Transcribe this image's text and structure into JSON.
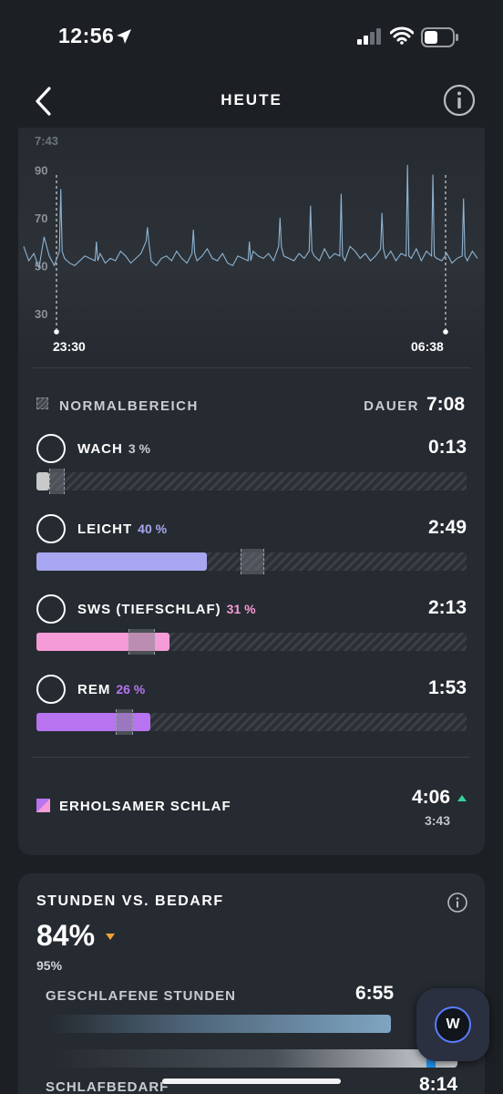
{
  "status_bar": {
    "time": "12:56"
  },
  "nav": {
    "title": "HEUTE"
  },
  "chart_data": {
    "type": "line",
    "title": "",
    "y_ticks": [
      "90",
      "70",
      "50",
      "30"
    ],
    "ylim": [
      20,
      100
    ],
    "peak_label": "7:43",
    "start_label": "23:30",
    "end_label": "06:38",
    "series": [
      {
        "values": [
          58,
          52,
          55,
          49,
          62,
          54,
          50,
          56,
          53,
          51,
          50,
          52,
          54,
          53,
          52,
          55,
          51,
          53,
          52,
          56,
          54,
          51,
          53,
          55,
          60,
          52,
          50,
          53,
          54,
          52,
          56,
          53,
          51,
          55,
          52,
          54,
          57,
          53,
          52,
          55,
          51,
          50,
          54,
          53,
          52,
          56,
          54,
          53,
          55,
          52,
          58,
          54,
          53,
          52,
          55,
          53,
          56,
          54,
          52,
          57,
          53,
          55,
          54,
          52,
          58,
          56,
          53,
          55,
          52,
          54,
          57,
          53,
          56,
          52,
          55,
          54,
          53,
          57,
          52,
          56,
          54,
          53,
          52,
          55,
          51,
          53,
          54,
          52,
          56,
          53
        ]
      }
    ],
    "spikes": [
      {
        "index": 7,
        "value": 82
      },
      {
        "index": 14,
        "value": 60
      },
      {
        "index": 24,
        "value": 66
      },
      {
        "index": 33,
        "value": 65
      },
      {
        "index": 44,
        "value": 60
      },
      {
        "index": 50,
        "value": 70
      },
      {
        "index": 56,
        "value": 75
      },
      {
        "index": 62,
        "value": 80
      },
      {
        "index": 70,
        "value": 72
      },
      {
        "index": 75,
        "value": 92
      },
      {
        "index": 80,
        "value": 88
      },
      {
        "index": 86,
        "value": 78
      }
    ]
  },
  "sleep": {
    "normal_range_label": "NORMALBEREICH",
    "duration_label": "DAUER",
    "duration_value": "7:08",
    "stages": [
      {
        "name": "WACH",
        "pct": "3 %",
        "duration": "0:13",
        "color": "#c9c9c9",
        "pct_color": "#c9ccd0",
        "fill": 0.03,
        "norm_start": 0.03,
        "norm_end": 0.065
      },
      {
        "name": "LEICHT",
        "pct": "40 %",
        "duration": "2:49",
        "color": "#a8a6f0",
        "pct_color": "#a8a6f0",
        "fill": 0.396,
        "norm_start": 0.475,
        "norm_end": 0.53
      },
      {
        "name": "SWS (TIEFSCHLAF)",
        "pct": "31 %",
        "duration": "2:13",
        "color": "#f59bd8",
        "pct_color": "#f59bd8",
        "fill": 0.31,
        "norm_start": 0.215,
        "norm_end": 0.275
      },
      {
        "name": "REM",
        "pct": "26 %",
        "duration": "1:53",
        "color": "#b873f0",
        "pct_color": "#b873f0",
        "fill": 0.265,
        "norm_start": 0.185,
        "norm_end": 0.225
      }
    ],
    "restorative": {
      "label": "ERHOLSAMER SCHLAF",
      "value": "4:06",
      "previous": "3:43"
    }
  },
  "hours_vs_need": {
    "title": "STUNDEN VS. BEDARF",
    "percent": "84%",
    "previous": "95%",
    "slept_label": "GESCHLAFENE STUNDEN",
    "slept_value": "6:55",
    "need_label": "SCHLAFBEDARF",
    "need_value": "8:14"
  },
  "fab": {
    "letter": "W"
  },
  "colors": {
    "background": "#1c2025",
    "card": "#262b31",
    "accent_up": "#34d39a",
    "accent_down": "#f0a23a"
  }
}
